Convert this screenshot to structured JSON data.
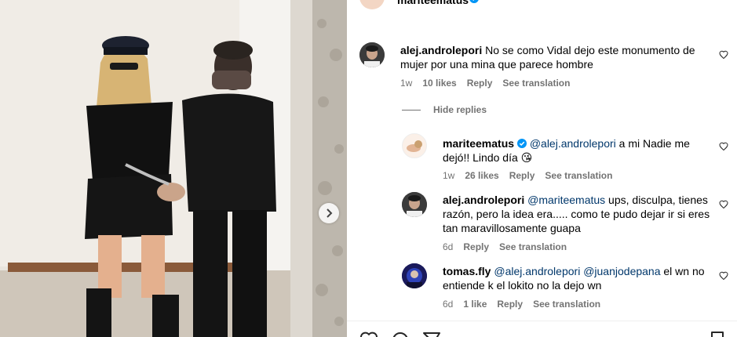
{
  "post": {
    "author": "mariteematus",
    "more_label": "···"
  },
  "comments": [
    {
      "user": "alej.androlepori",
      "text": "No se como Vidal dejo este monumento de mujer por una mina que parece hombre",
      "time": "1w",
      "likes": "10 likes",
      "reply": "Reply",
      "translate": "See translation"
    }
  ],
  "hide_replies": "Hide replies",
  "replies": [
    {
      "user": "mariteematus",
      "mention": "@alej.androlepori",
      "text": " a mi Nadie me dejó!! Lindo día 😘",
      "time": "1w",
      "likes": "26 likes",
      "reply": "Reply",
      "translate": "See translation"
    },
    {
      "user": "alej.androlepori",
      "mention": "@mariteematus",
      "text": " ups, disculpa, tienes razón, pero la idea era..... como te pudo dejar ir si eres tan maravillosamente guapa",
      "time": "6d",
      "reply": "Reply",
      "translate": "See translation"
    },
    {
      "user": "tomas.fly",
      "mention": "@alej.androlepori",
      "mention2": "@juanjodepana",
      "text": " el wn no entiende k el lokito no la dejo wn",
      "time": "6d",
      "likes": "1 like",
      "reply": "Reply",
      "translate": "See translation"
    }
  ],
  "colors": {
    "secondary_text": "#737373",
    "mention": "#00376b",
    "verified": "#0095f6"
  }
}
